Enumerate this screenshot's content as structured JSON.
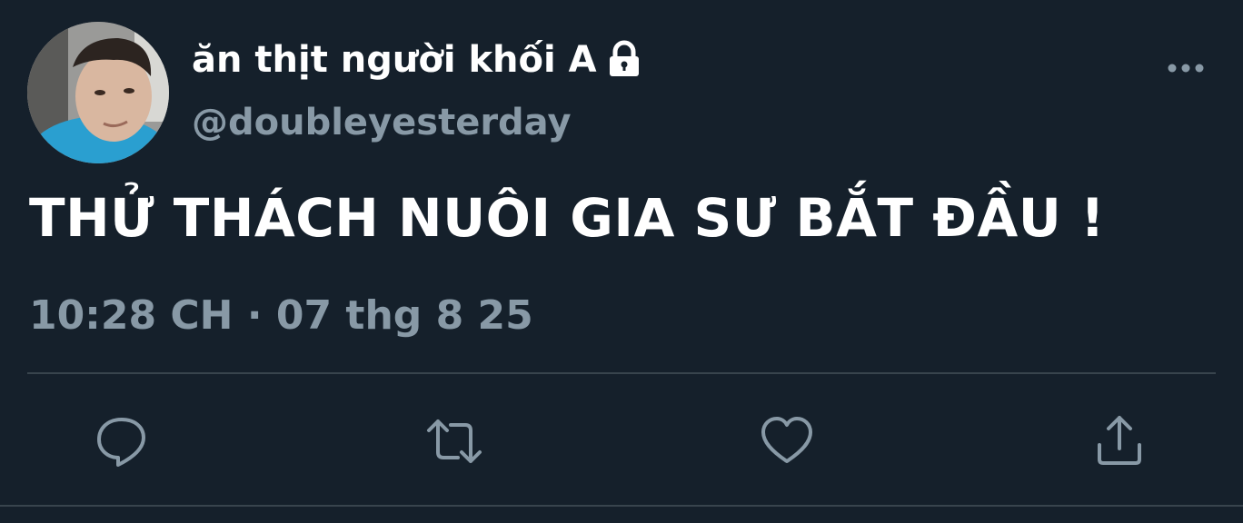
{
  "author": {
    "display_name": "ăn thịt người khối A",
    "handle": "@doubleyesterday",
    "protected": true
  },
  "tweet": {
    "text": "THỬ THÁCH NUÔI GIA SƯ BẮT ĐẦU !"
  },
  "meta": {
    "time": "10:28 CH",
    "separator": "·",
    "date": "07 thg 8 25"
  },
  "icons": {
    "more": "more-icon",
    "lock": "lock-icon",
    "reply": "reply-icon",
    "retweet": "retweet-icon",
    "like": "heart-icon",
    "share": "share-icon"
  },
  "colors": {
    "background": "#15202b",
    "primary_text": "#ffffff",
    "secondary_text": "#8899a6",
    "divider": "#38444d"
  }
}
